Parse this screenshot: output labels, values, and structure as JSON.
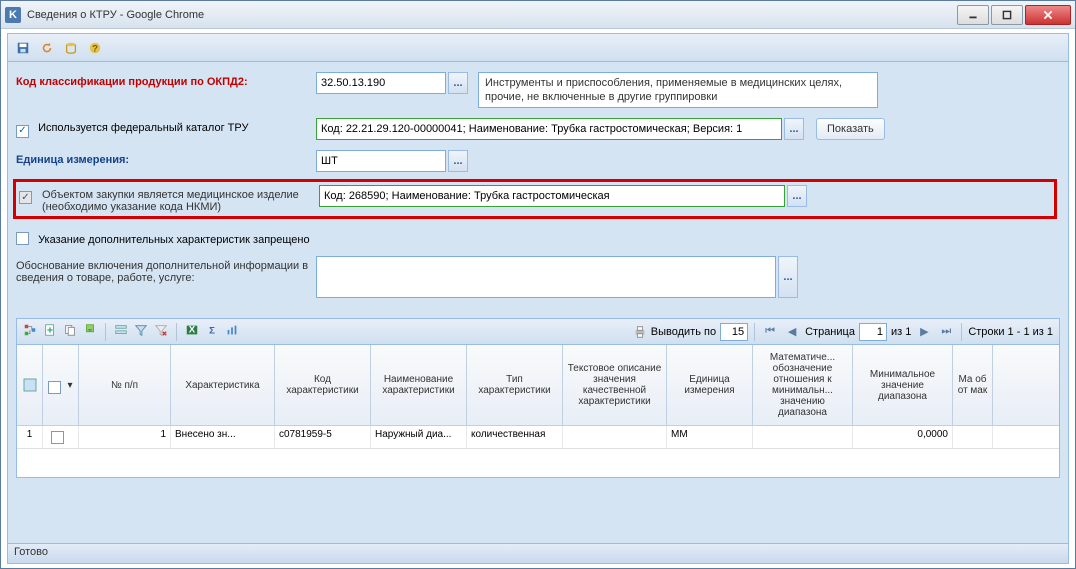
{
  "window": {
    "title": "Сведения о КТРУ - Google Chrome",
    "app_icon_letter": "K"
  },
  "toolbar_icons": [
    "save-icon",
    "refresh-icon",
    "db-icon",
    "help-icon"
  ],
  "form": {
    "okpd2_label": "Код классификации продукции по ОКПД2:",
    "okpd2_value": "32.50.13.190",
    "okpd2_desc": "Инструменты и приспособления, применяемые в медицинских целях, прочие, не включенные в другие группировки",
    "fed_catalog_label": "Используется федеральный каталог ТРУ",
    "fed_catalog_value": "Код: 22.21.29.120-00000041; Наименование: Трубка гастростомическая; Версия: 1",
    "show_button": "Показать",
    "unit_label": "Единица измерения:",
    "unit_value": "ШТ",
    "med_label_line1": "Объектом закупки является медицинское изделие",
    "med_label_line2": "(необходимо указание кода НКМИ)",
    "med_value": "Код: 268590; Наименование: Трубка гастростомическая",
    "extra_char_label": "Указание дополнительных характеристик запрещено",
    "justification_label": "Обоснование включения дополнительной информации в сведения о товаре, работе, услуге:",
    "justification_value": ""
  },
  "grid": {
    "per_page_label": "Выводить по",
    "per_page_value": "15",
    "page_label": "Страница",
    "page_value": "1",
    "page_total_label": "из 1",
    "rows_label": "Строки 1 - 1 из 1",
    "headers": {
      "row_sel": "",
      "chk": "",
      "num": "№ п/п",
      "char": "Характеристика",
      "code": "Код характеристики",
      "name": "Наименование характеристики",
      "type": "Тип характеристики",
      "text_desc": "Текстовое описание значения качественной характеристики",
      "unit": "Единица измерения",
      "math": "Математиче... обозначение отношения к минимальн... значению диапазона",
      "min": "Минимальное значение диапазона",
      "max": "Ма об от мак"
    },
    "row1": {
      "idx": "1",
      "num": "1",
      "char": "Внесено зн...",
      "code": "c0781959-5",
      "name": "Наружный диа...",
      "type": "количественная",
      "text_desc": "",
      "unit": "ММ",
      "math": "",
      "min": "0,0000",
      "max": ""
    }
  },
  "status": "Готово"
}
